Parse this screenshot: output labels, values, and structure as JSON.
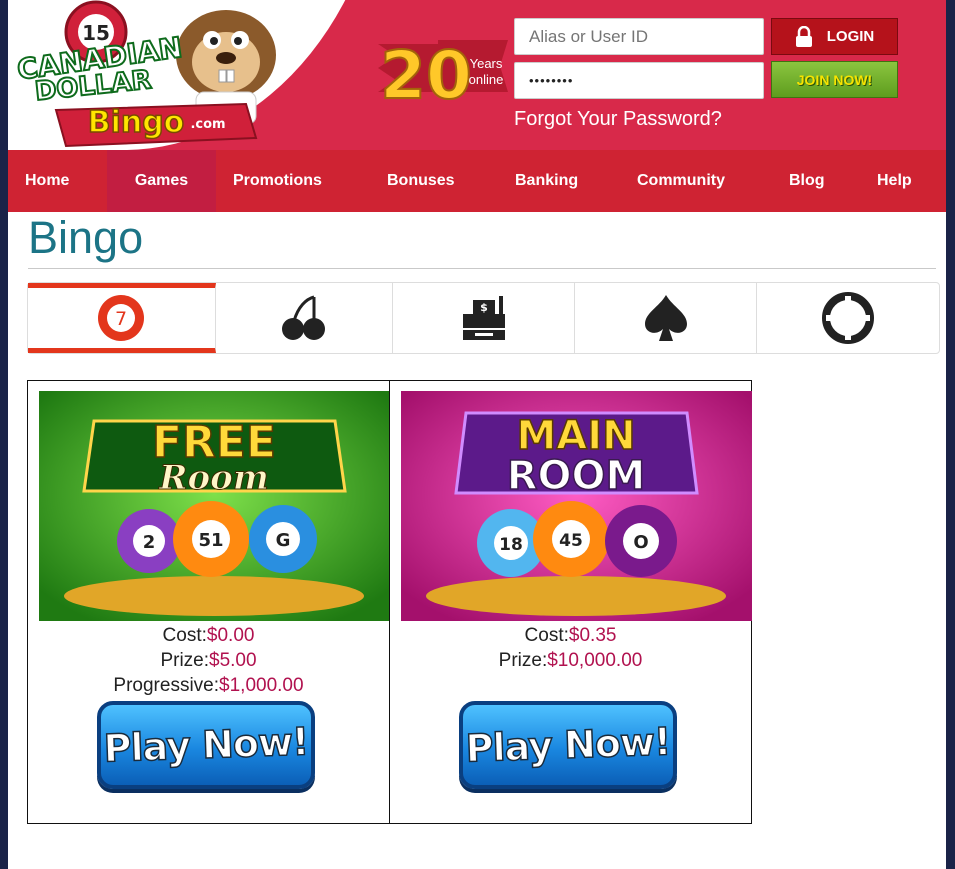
{
  "header": {
    "logo": {
      "badge_number": "15",
      "line1": "CANADIAN",
      "line2": "DOLLAR",
      "line3": "Bingo",
      "line3_suffix": ".com"
    },
    "anniversary": {
      "number": "20",
      "line1": "Years",
      "line2": "online"
    },
    "login": {
      "alias_placeholder": "Alias or User ID",
      "password_value": "••••••••",
      "login_label": "LOGIN",
      "join_label": "JOIN NOW!",
      "forgot_label": "Forgot Your Password?"
    }
  },
  "nav": {
    "items": [
      {
        "label": "Home"
      },
      {
        "label": "Games"
      },
      {
        "label": "Promotions"
      },
      {
        "label": "Bonuses"
      },
      {
        "label": "Banking"
      },
      {
        "label": "Community"
      },
      {
        "label": "Blog"
      },
      {
        "label": "Help"
      }
    ],
    "active": "Games"
  },
  "page": {
    "title": "Bingo",
    "tabs": [
      {
        "icon": "bingo-ball-icon",
        "ball_number": "7",
        "active": true
      },
      {
        "icon": "cherries-icon",
        "active": false
      },
      {
        "icon": "cash-register-icon",
        "active": false
      },
      {
        "icon": "spade-icon",
        "active": false
      },
      {
        "icon": "lifebuoy-icon",
        "active": false
      }
    ]
  },
  "rooms": [
    {
      "art_line1": "FREE",
      "art_line2": "Room",
      "balls": [
        "2",
        "51",
        "G"
      ],
      "cost_label": "Cost:",
      "cost": "$0.00",
      "prize_label": "Prize:",
      "prize": "$5.00",
      "progressive_label": "Progressive:",
      "progressive": "$1,000.00",
      "play_label": "Play Now!"
    },
    {
      "art_line1": "MAIN",
      "art_line2": "ROOM",
      "balls": [
        "18",
        "45",
        "O"
      ],
      "cost_label": "Cost:",
      "cost": "$0.35",
      "prize_label": "Prize:",
      "prize": "$10,000.00",
      "play_label": "Play Now!"
    }
  ],
  "colors": {
    "header_red": "#d8294a",
    "nav_red": "#cf2333",
    "title_teal": "#1c7486",
    "value_magenta": "#b1124f",
    "tab_accent": "#e3361c"
  }
}
